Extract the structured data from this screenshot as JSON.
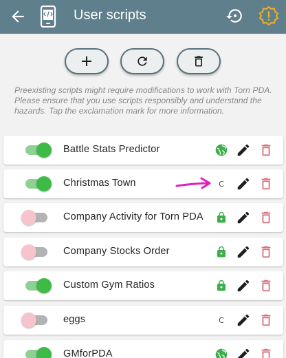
{
  "header": {
    "title": "User scripts"
  },
  "notice": "Preexisting scripts might require modifications to work with Torn PDA. Please ensure that you use scripts responsibly and understand the hazards. Tap the exclamation mark for more information.",
  "colors": {
    "appbar": "#5f7f8c",
    "toggle_on": "#3dbb46",
    "toggle_off_thumb": "#f6c4cc",
    "globe": "#3dae4a",
    "lock": "#3dae4a",
    "delete": "#d9727e",
    "annotation_arrow": "#e020c0"
  },
  "toolbar": {
    "add_icon": "plus-icon",
    "reload_icon": "refresh-icon",
    "delete_all_icon": "trash-icon"
  },
  "scripts": [
    {
      "name": "Battle Stats Predictor",
      "enabled": true,
      "source": "globe"
    },
    {
      "name": "Christmas Town",
      "enabled": true,
      "source": "custom",
      "source_label": "C"
    },
    {
      "name": "Company Activity for Torn PDA",
      "enabled": false,
      "source": "lock"
    },
    {
      "name": "Company Stocks Order",
      "enabled": false,
      "source": "lock"
    },
    {
      "name": "Custom Gym Ratios",
      "enabled": true,
      "source": "lock"
    },
    {
      "name": "eggs",
      "enabled": false,
      "source": "custom",
      "source_label": "C"
    },
    {
      "name": "GMforPDA",
      "enabled": true,
      "source": "globe"
    }
  ]
}
